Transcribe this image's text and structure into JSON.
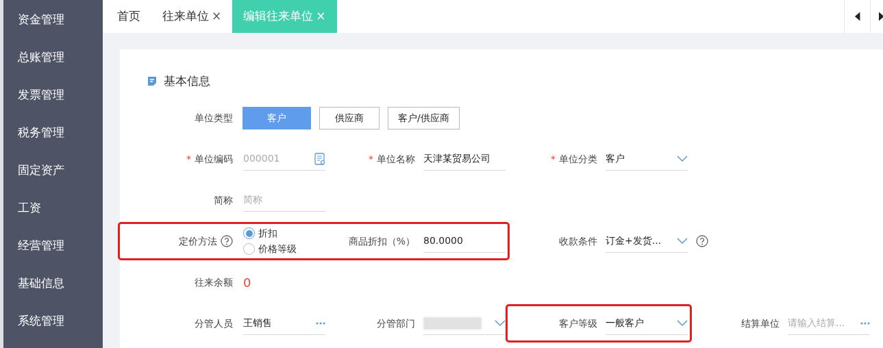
{
  "sidebar": {
    "items": [
      {
        "label": "资金管理",
        "selected": false
      },
      {
        "label": "总账管理",
        "selected": false
      },
      {
        "label": "发票管理",
        "selected": false
      },
      {
        "label": "税务管理",
        "selected": false
      },
      {
        "label": "固定资产",
        "selected": false
      },
      {
        "label": "工资",
        "selected": false
      },
      {
        "label": "经营管理",
        "selected": false
      },
      {
        "label": "基础信息",
        "selected": false
      },
      {
        "label": "系统管理",
        "selected": false
      }
    ]
  },
  "tabs": [
    {
      "label": "首页",
      "selected": false
    },
    {
      "label": "往来单位",
      "selected": false,
      "close_mark": "×"
    },
    {
      "label": "编辑往来单位",
      "selected": true,
      "close_mark": "×"
    }
  ],
  "section": {
    "title": "基本信息"
  },
  "unit_type": {
    "label": "单位类型",
    "options": [
      {
        "label": "客户",
        "selected": true
      },
      {
        "label": "供应商",
        "selected": false
      },
      {
        "label": "客户/供应商",
        "selected": false
      }
    ]
  },
  "rows": [
    {
      "groups": [
        {
          "highlighted": false,
          "fields": [
            {
              "kind": "code",
              "label": "单位编码",
              "required_mark": "*",
              "placeholder": "000001"
            },
            {
              "kind": "input",
              "label": "单位名称",
              "required_mark": "*",
              "value": "天津某贸易公司"
            },
            {
              "kind": "select",
              "label": "单位分类",
              "required_mark": "*",
              "value": "客户"
            }
          ]
        }
      ]
    },
    {
      "groups": [
        {
          "highlighted": false,
          "fields": [
            {
              "kind": "input",
              "label": "简称",
              "placeholder": "简称"
            }
          ]
        }
      ]
    },
    {
      "groups": [
        {
          "highlighted": true,
          "fields": [
            {
              "kind": "radio",
              "label": "定价方法",
              "help": true,
              "options": [
                {
                  "label": "折扣",
                  "selected": true
                },
                {
                  "label": "价格等级",
                  "selected": false
                }
              ]
            },
            {
              "kind": "input",
              "label": "商品折扣（%）",
              "value": "80.0000"
            }
          ]
        },
        {
          "highlighted": false,
          "fields": [
            {
              "kind": "select",
              "label": "收款条件",
              "value": "订金+发货...",
              "help": true
            }
          ]
        }
      ]
    },
    {
      "groups": [
        {
          "highlighted": false,
          "fields": [
            {
              "kind": "amount",
              "label": "往来余额",
              "value": "0"
            }
          ]
        }
      ]
    },
    {
      "groups": [
        {
          "highlighted": false,
          "fields": [
            {
              "kind": "lookup",
              "label": "分管人员",
              "value": "王销售"
            },
            {
              "kind": "redacted",
              "label": "分管部门"
            }
          ]
        },
        {
          "highlighted": true,
          "fields": [
            {
              "kind": "select",
              "label": "客户等级",
              "value": "一般客户"
            }
          ]
        },
        {
          "highlighted": false,
          "fields": [
            {
              "kind": "lookup",
              "label": "结算单位",
              "placeholder": "请输入结算..."
            }
          ]
        }
      ]
    }
  ]
}
